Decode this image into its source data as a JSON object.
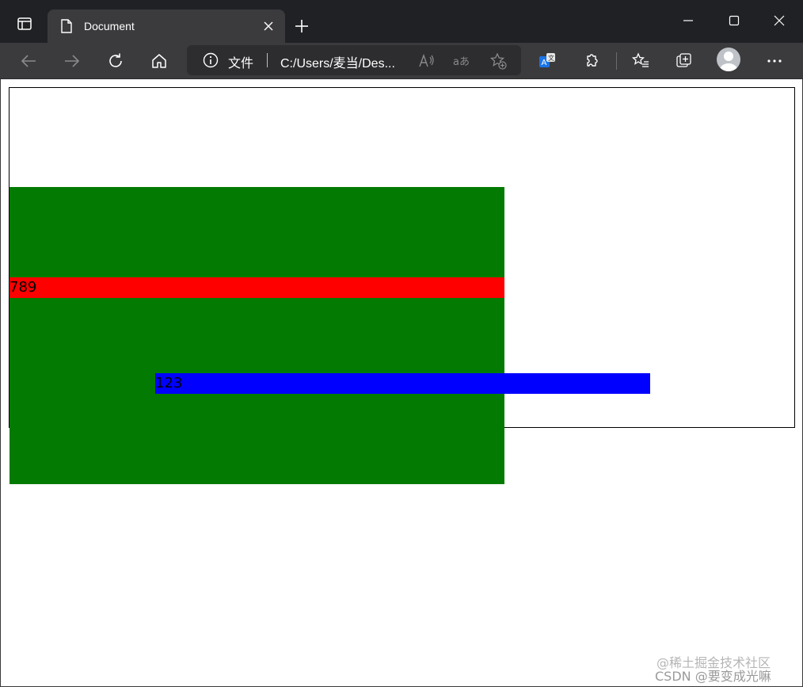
{
  "tab": {
    "title": "Document"
  },
  "address_bar": {
    "label": "文件",
    "url": "C:/Users/麦当/Des..."
  },
  "page": {
    "red_text": "789",
    "blue_text": "123"
  },
  "watermarks": {
    "line1": "@稀土掘金技术社区",
    "line2": "CSDN @要变成光嘛"
  },
  "colors": {
    "green": "#037b03",
    "red": "#ff0000",
    "blue": "#0000ff",
    "chrome_dark": "#202124",
    "chrome_toolbar": "#3b3b3e"
  },
  "icons": [
    "tab-actions-icon",
    "document-icon",
    "close-icon",
    "plus-icon",
    "minimize-icon",
    "maximize-icon",
    "window-close-icon",
    "back-icon",
    "forward-icon",
    "refresh-icon",
    "home-icon",
    "info-icon",
    "read-aloud-icon",
    "immersive-reader-icon",
    "add-favorite-icon",
    "translate-icon",
    "extensions-icon",
    "favorites-icon",
    "collections-icon",
    "profile-icon",
    "more-icon"
  ]
}
